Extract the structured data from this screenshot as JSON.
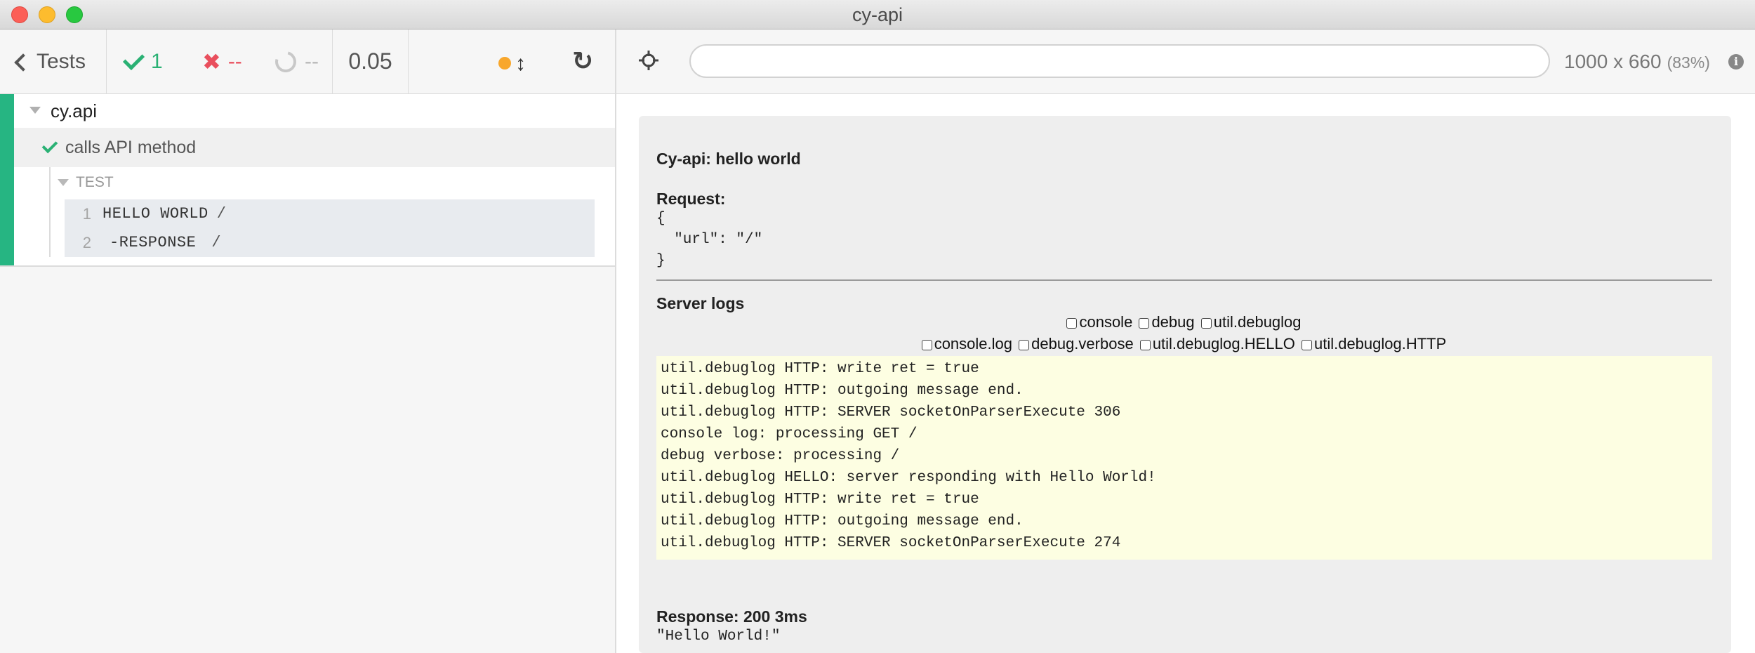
{
  "window": {
    "title": "cy-api"
  },
  "reporter": {
    "header": {
      "tests_label": "Tests",
      "passed": "1",
      "failed": "--",
      "pending": "--",
      "duration": "0.05"
    },
    "suite": {
      "title": "cy.api",
      "test": {
        "title": "calls API method",
        "state": "passed",
        "group_title": "TEST",
        "commands": [
          {
            "number": "1",
            "name": "HELLO WORLD",
            "message": "/"
          },
          {
            "number": "2",
            "name": "-RESPONSE",
            "message": "/"
          }
        ]
      }
    }
  },
  "aut": {
    "url": "",
    "viewport": "1000 x 660",
    "scale": "(83%)",
    "app": {
      "title": "Cy-api: hello world",
      "request_label": "Request:",
      "request_body": "{\n  \"url\": \"/\"\n}",
      "server_logs_label": "Server logs",
      "filters_row1": [
        "console",
        "debug",
        "util.debuglog"
      ],
      "filters_row2": [
        "console.log",
        "debug.verbose",
        "util.debuglog.HELLO",
        "util.debuglog.HTTP"
      ],
      "logs": [
        "util.debuglog HTTP: write ret = true",
        "util.debuglog HTTP: outgoing message end.",
        "util.debuglog HTTP: SERVER socketOnParserExecute 306",
        "console log: processing GET /",
        "debug verbose: processing /",
        "util.debuglog HELLO: server responding with Hello World!",
        "util.debuglog HTTP: write ret = true",
        "util.debuglog HTTP: outgoing message end.",
        "util.debuglog HTTP: SERVER socketOnParserExecute 274"
      ],
      "response_label": "Response: 200 3ms",
      "response_body": "\"Hello World!\""
    }
  },
  "colors": {
    "passed": "#2ab174",
    "failed": "#e94f5d",
    "suite_bar": "#26b582",
    "running_dot": "#f8a72c",
    "logs_background": "#fdfee2"
  },
  "icons": [
    "chevron-left-icon",
    "check-icon",
    "x-icon",
    "pending-spinner-icon",
    "resize-icon",
    "reload-icon",
    "selector-playground-icon",
    "info-icon",
    "caret-down-icon"
  ]
}
